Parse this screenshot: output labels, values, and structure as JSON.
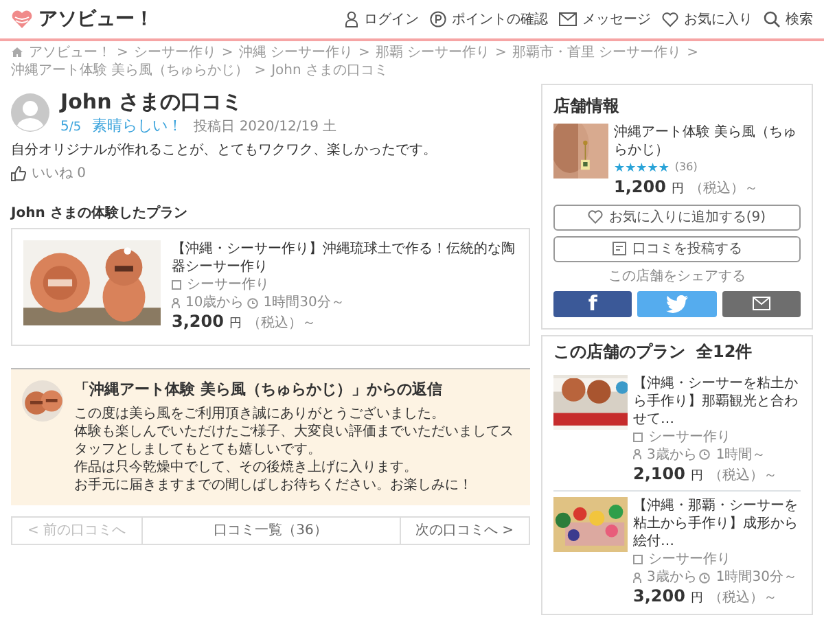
{
  "header": {
    "logo": "アソビュー！",
    "nav": [
      {
        "label": "ログイン"
      },
      {
        "label": "ポイントの確認"
      },
      {
        "label": "メッセージ"
      },
      {
        "label": "お気に入り"
      },
      {
        "label": "検索"
      }
    ]
  },
  "breadcrumb": {
    "separator": ">",
    "items": [
      "アソビュー！",
      "シーサー作り",
      "沖縄 シーサー作り",
      "那覇 シーサー作り",
      "那覇市・首里 シーサー作り",
      "沖縄アート体験 美ら風（ちゅらかじ）",
      "John さまの口コミ"
    ]
  },
  "review": {
    "title": "John さまの口コミ",
    "score": "5",
    "score_max": "/5",
    "verdict": "素晴らしい！",
    "posted": "投稿日 2020/12/19 土",
    "comment": "自分オリジナルが作れることが、とてもワクワク、楽しかったです。",
    "like": "いいね 0"
  },
  "plan": {
    "heading": "John さまの体験したプラン",
    "title": "【沖縄・シーサー作り】沖縄琉球土で作る！伝統的な陶器シーサー作り",
    "category": "シーサー作り",
    "age": "10歳から",
    "duration": "1時間30分～",
    "price": "3,200",
    "unit": "円",
    "tax": "（税込）～"
  },
  "reply": {
    "title": "「沖縄アート体験 美ら風（ちゅらかじ）」からの返信",
    "lines": [
      "この度は美ら風をご利用頂き誠にありがとうございました。",
      "体験も楽しんでいただけたご様子、大変良い評価までいただいましてスタッフとしましてもとても嬉しいです。",
      "作品は只今乾燥中でして、その後焼き上げに入ります。",
      "お手元に届きますまでの間しばしお待ちください。お楽しみに！"
    ]
  },
  "pager": [
    {
      "label": "< 前の口コミへ",
      "disabled": true
    },
    {
      "label": "口コミ一覧（36）",
      "disabled": false
    },
    {
      "label": "次の口コミへ >",
      "disabled": false
    }
  ],
  "shop": {
    "heading": "店舗情報",
    "name": "沖縄アート体験 美ら風（ちゅらかじ）",
    "stars": 5,
    "reviews": "(36)",
    "price": "1,200",
    "unit": "円",
    "tax": "（税込）～",
    "favorite": "お気に入りに追加する(9)",
    "post": "口コミを投稿する",
    "share_label": "この店舗をシェアする",
    "share": [
      {
        "kind": "facebook",
        "label": "f"
      },
      {
        "kind": "twitter"
      },
      {
        "kind": "mail"
      }
    ]
  },
  "shop_plans": {
    "heading": "この店舗のプラン",
    "count": "全12件",
    "items": [
      {
        "title": "【沖縄・シーサーを粘土から手作り】那覇観光と合わせて…",
        "category": "シーサー作り",
        "age": "3歳から",
        "duration": "1時間～",
        "price": "2,100",
        "unit": "円",
        "tax": "（税込）～"
      },
      {
        "title": "【沖縄・那覇・シーサーを粘土から手作り】成形から絵付…",
        "category": "シーサー作り",
        "age": "3歳から",
        "duration": "1時間30分～",
        "price": "3,200",
        "unit": "円",
        "tax": "（税込）～"
      }
    ]
  }
}
